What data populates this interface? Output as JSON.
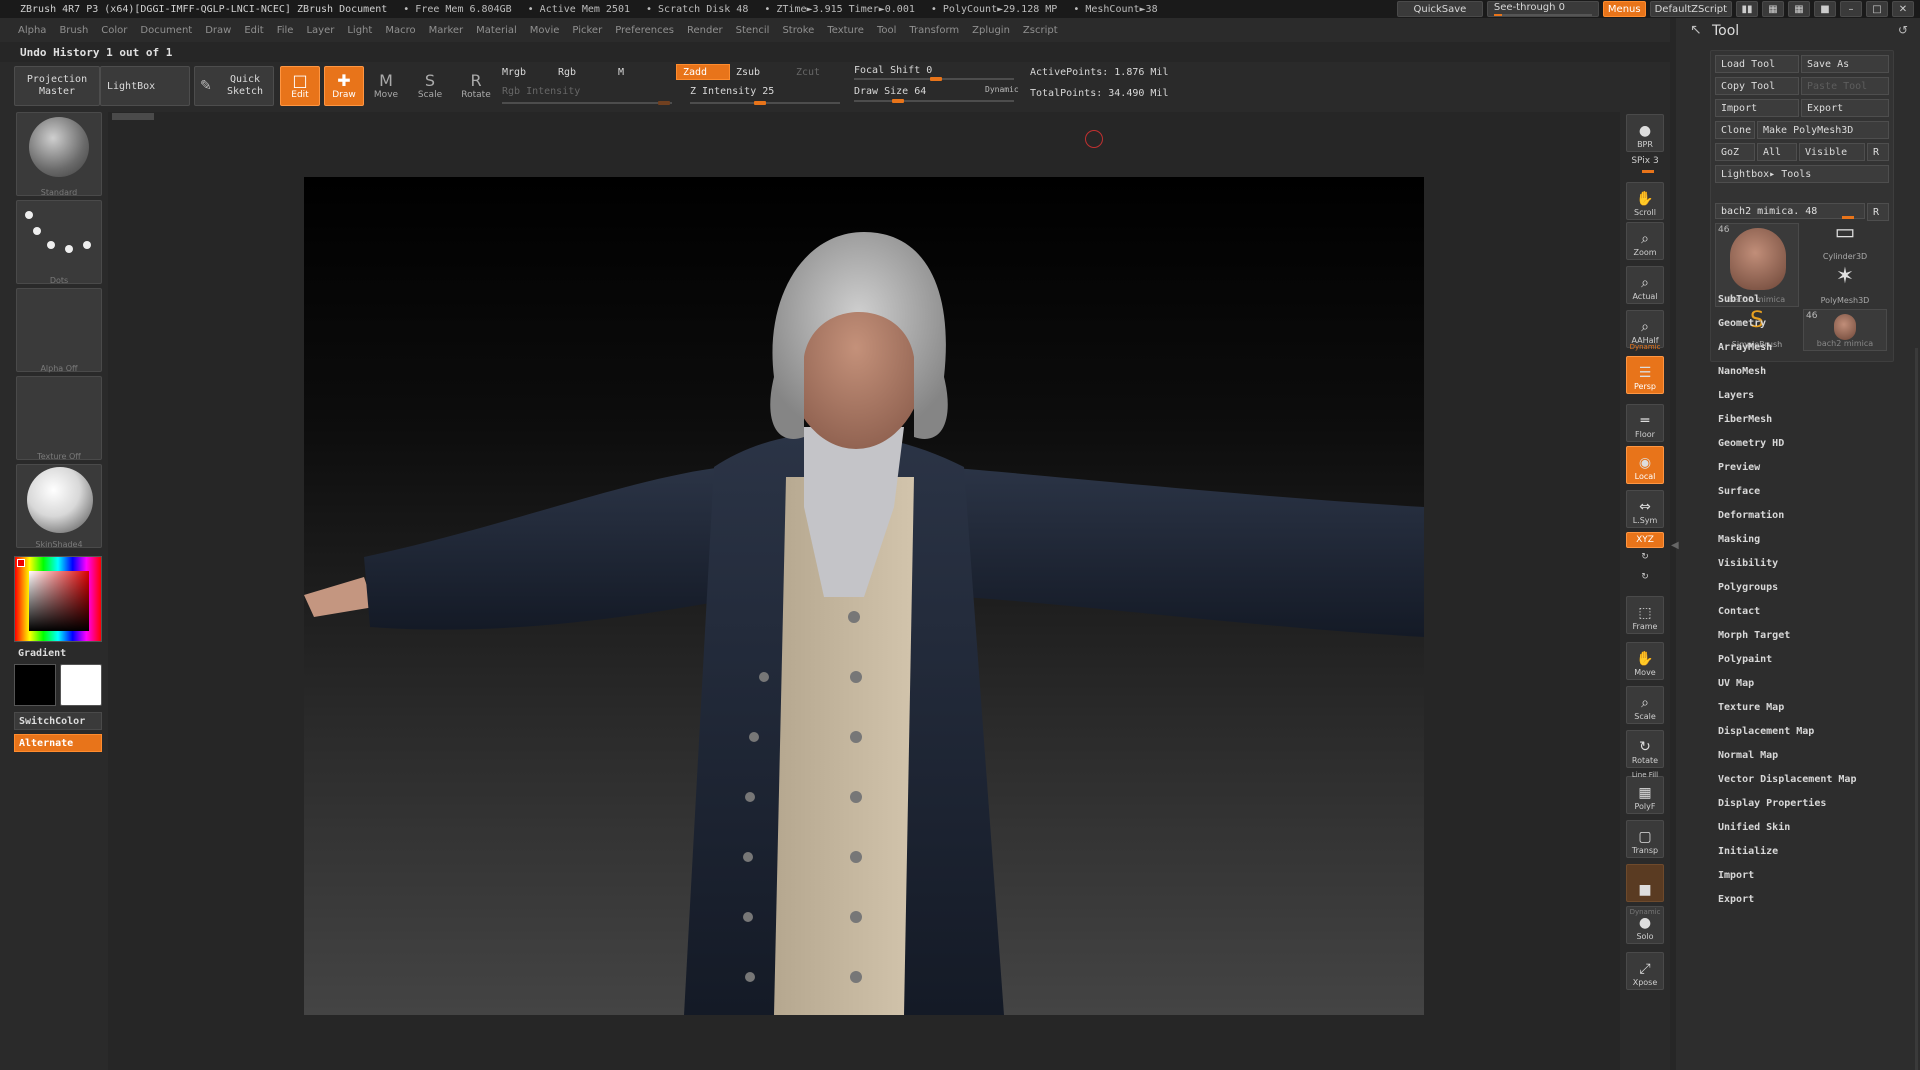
{
  "titlebar": {
    "title": "ZBrush 4R7 P3 (x64)[DGGI-IMFF-QGLP-LNCI-NCEC]    ZBrush Document",
    "free_mem": "• Free Mem 6.804GB",
    "active_mem": "• Active Mem 2501",
    "scratch": "• Scratch Disk 48",
    "ztime": "• ZTime►3.915 Timer►0.001",
    "polycount": "• PolyCount►29.128 MP",
    "meshcount": "• MeshCount►38",
    "quicksave": "QuickSave",
    "see_through": "See-through  0",
    "menus": "Menus",
    "default_script": "DefaultZScript"
  },
  "menus": [
    "Alpha",
    "Brush",
    "Color",
    "Document",
    "Draw",
    "Edit",
    "File",
    "Layer",
    "Light",
    "Macro",
    "Marker",
    "Material",
    "Movie",
    "Picker",
    "Preferences",
    "Render",
    "Stencil",
    "Stroke",
    "Texture",
    "Tool",
    "Transform",
    "Zplugin",
    "Zscript"
  ],
  "undo": "Undo History 1 out of 1",
  "toolbar": {
    "projection_master": "Projection\nMaster",
    "lightbox": "LightBox",
    "quick_sketch": "Quick\nSketch",
    "edit": "Edit",
    "draw": "Draw",
    "move": "Move",
    "scale": "Scale",
    "rotate": "Rotate",
    "mrgb": "Mrgb",
    "rgb": "Rgb",
    "m": "M",
    "rgb_intensity": "Rgb Intensity",
    "zadd": "Zadd",
    "zsub": "Zsub",
    "zcut": "Zcut",
    "z_intensity": "Z Intensity 25",
    "focal_shift": "Focal Shift 0",
    "draw_size": "Draw Size 64",
    "dynamic": "Dynamic",
    "active_points": "ActivePoints: 1.876 Mil",
    "total_points": "TotalPoints: 34.490 Mil"
  },
  "left": {
    "brush_label": "Standard",
    "stroke_label": "Dots",
    "alpha_label": "Alpha  Off",
    "texture_label": "Texture  Off",
    "material_label": "SkinShade4",
    "gradient": "Gradient",
    "switch_color": "SwitchColor",
    "alternate": "Alternate"
  },
  "shelf": [
    {
      "name": "bpr",
      "label": "BPR",
      "icon": "●"
    },
    {
      "name": "spix",
      "label": "SPix 3",
      "icon": ""
    },
    {
      "name": "scroll",
      "label": "Scroll",
      "icon": "✋"
    },
    {
      "name": "zoom",
      "label": "Zoom",
      "icon": "⌕"
    },
    {
      "name": "actual",
      "label": "Actual",
      "icon": "⌕"
    },
    {
      "name": "aahalf",
      "label": "AAHalf",
      "icon": "⌕"
    },
    {
      "name": "persp",
      "label": "Persp",
      "icon": "☰"
    },
    {
      "name": "floor",
      "label": "Floor",
      "icon": "═"
    },
    {
      "name": "local",
      "label": "Local",
      "icon": "◉"
    },
    {
      "name": "lsym",
      "label": "L.Sym",
      "icon": "⇔"
    },
    {
      "name": "xyz",
      "label": "XYZ",
      "icon": ""
    },
    {
      "name": "frame",
      "label": "Frame",
      "icon": "⬚"
    },
    {
      "name": "move",
      "label": "Move",
      "icon": "✋"
    },
    {
      "name": "scale",
      "label": "Scale",
      "icon": "⌕"
    },
    {
      "name": "rotate",
      "label": "Rotate",
      "icon": "↻"
    },
    {
      "name": "polyf",
      "label": "PolyF",
      "icon": "▦"
    },
    {
      "name": "transp",
      "label": "Transp",
      "icon": "▢"
    },
    {
      "name": "ghost",
      "label": "",
      "icon": "■"
    },
    {
      "name": "solo",
      "label": "Solo",
      "icon": "●"
    },
    {
      "name": "xpose",
      "label": "Xpose",
      "icon": "⤢"
    }
  ],
  "shelf_extra": {
    "dynamic": "Dynamic",
    "line_fill": "Line Fill",
    "dynamic2": "Dynamic"
  },
  "tool": {
    "title": "Tool",
    "load_tool": "Load Tool",
    "save_as": "Save As",
    "copy_tool": "Copy Tool",
    "paste_tool": "Paste Tool",
    "import": "Import",
    "export": "Export",
    "clone": "Clone",
    "make_polymesh": "Make PolyMesh3D",
    "goz": "GoZ",
    "all": "All",
    "visible": "Visible",
    "r": "R",
    "lightbox_tools": "Lightbox▸ Tools",
    "current_tool": "bach2 mimica. 48",
    "thumbs": [
      {
        "label": "bach2 mimica",
        "num": "46"
      },
      {
        "label": "Cylinder3D",
        "num": ""
      },
      {
        "label": "PolyMesh3D",
        "num": ""
      },
      {
        "label": "SimpleBrush",
        "num": ""
      },
      {
        "label": "bach2 mimica",
        "num": "46"
      }
    ],
    "sections": [
      "SubTool",
      "Geometry",
      "ArrayMesh",
      "NanoMesh",
      "Layers",
      "FiberMesh",
      "Geometry HD",
      "Preview",
      "Surface",
      "Deformation",
      "Masking",
      "Visibility",
      "Polygroups",
      "Contact",
      "Morph Target",
      "Polypaint",
      "UV Map",
      "Texture Map",
      "Displacement Map",
      "Normal Map",
      "Vector Displacement Map",
      "Display Properties",
      "Unified Skin",
      "Initialize",
      "Import",
      "Export"
    ]
  }
}
